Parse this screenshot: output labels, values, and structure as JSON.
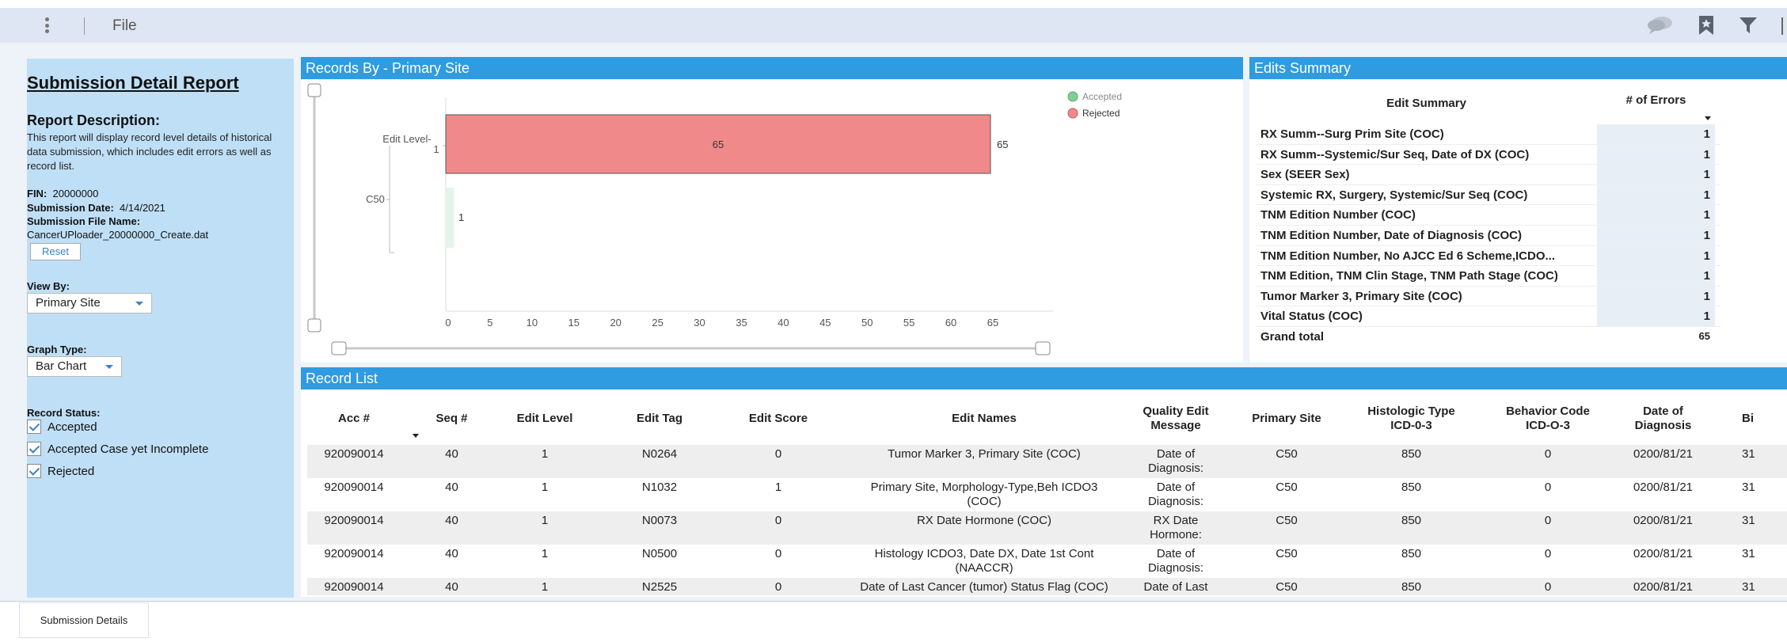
{
  "toolbar": {
    "file_label": "File"
  },
  "left": {
    "title": "Submission Detail Report",
    "desc_heading": "Report Description:",
    "description": "This report will display record level details of historical data submission, which includes edit errors as well as record list.",
    "fin_label": "FIN:",
    "fin_value": "20000000",
    "date_label": "Submission Date:",
    "date_value": "4/14/2021",
    "file_label": "Submission File Name:",
    "file_value": "CancerUPloader_20000000_Create.dat",
    "reset_label": "Reset",
    "view_by_label": "View By:",
    "view_by_value": "Primary Site",
    "graph_type_label": "Graph Type:",
    "graph_type_value": "Bar Chart",
    "record_status_label": "Record Status:",
    "statuses": [
      "Accepted",
      "Accepted Case yet Incomplete",
      "Rejected"
    ]
  },
  "chart_panel": {
    "title": "Records By - Primary Site"
  },
  "chart_data": {
    "type": "bar",
    "orientation": "horizontal",
    "categories": [
      "C50"
    ],
    "sub_category_label": "Edit Level-1",
    "series": [
      {
        "name": "Accepted",
        "color": "#7fcf95",
        "values": [
          1
        ]
      },
      {
        "name": "Rejected",
        "color": "#f08a8a",
        "values": [
          65
        ]
      }
    ],
    "xticks": [
      "0",
      "5",
      "10",
      "15",
      "20",
      "25",
      "30",
      "35",
      "40",
      "45",
      "50",
      "55",
      "60",
      "65"
    ],
    "xlim": [
      0,
      65
    ],
    "bar_inner_label": "65",
    "bar_end_label": "65",
    "accepted_label": "1",
    "legend_placement": "top-right"
  },
  "edits_panel": {
    "title": "Edits Summary",
    "col_name": "Edit Summary",
    "col_errors": "# of Errors",
    "rows": [
      {
        "name": "RX Summ--Surg Prim Site (COC)",
        "errors": "1"
      },
      {
        "name": "RX Summ--Systemic/Sur Seq, Date of DX (COC)",
        "errors": "1"
      },
      {
        "name": "Sex (SEER Sex)",
        "errors": "1"
      },
      {
        "name": "Systemic RX, Surgery, Systemic/Sur Seq (COC)",
        "errors": "1"
      },
      {
        "name": "TNM Edition Number (COC)",
        "errors": "1"
      },
      {
        "name": "TNM Edition Number, Date of Diagnosis (COC)",
        "errors": "1"
      },
      {
        "name": "TNM Edition Number, No AJCC Ed 6 Scheme,ICDO...",
        "errors": "1"
      },
      {
        "name": "TNM Edition, TNM Clin Stage, TNM Path Stage (COC)",
        "errors": "1"
      },
      {
        "name": "Tumor Marker 3, Primary Site (COC)",
        "errors": "1"
      },
      {
        "name": "Vital Status (COC)",
        "errors": "1"
      }
    ],
    "total_label": "Grand total",
    "total_value": "65"
  },
  "record_list": {
    "title": "Record List",
    "headers": [
      "Acc #",
      "Seq #",
      "Edit Level",
      "Edit Tag",
      "Edit Score",
      "Edit Names",
      "Quality Edit Message",
      "Primary Site",
      "Histologic Type ICD-0-3",
      "Behavior Code ICD-O-3",
      "Date of Diagnosis",
      "Bi"
    ],
    "rows": [
      [
        "920090014",
        "40",
        "1",
        "N0264",
        "0",
        "Tumor Marker 3, Primary Site (COC)",
        "Date of Diagnosis: ...",
        "C50",
        "850",
        "0",
        "0200/81/21",
        "31"
      ],
      [
        "920090014",
        "40",
        "1",
        "N1032",
        "1",
        "Primary Site, Morphology-Type,Beh ICDO3 (COC)",
        "Date of Diagnosis: ...",
        "C50",
        "850",
        "0",
        "0200/81/21",
        "31"
      ],
      [
        "920090014",
        "40",
        "1",
        "N0073",
        "0",
        "RX Date Hormone (COC)",
        "RX Date Hormone: inval...",
        "C50",
        "850",
        "0",
        "0200/81/21",
        "31"
      ],
      [
        "920090014",
        "40",
        "1",
        "N0500",
        "0",
        "Histology ICDO3, Date DX, Date 1st Cont (NAACCR)",
        "Date of Diagnosis: ...",
        "C50",
        "850",
        "0",
        "0200/81/21",
        "31"
      ],
      [
        "920090014",
        "40",
        "1",
        "N2525",
        "0",
        "Date of Last Cancer (tumor) Status Flag (COC)",
        "Date of Last",
        "C50",
        "850",
        "0",
        "0200/81/21",
        "31"
      ]
    ]
  },
  "bottom": {
    "tab_label": "Submission Details"
  }
}
